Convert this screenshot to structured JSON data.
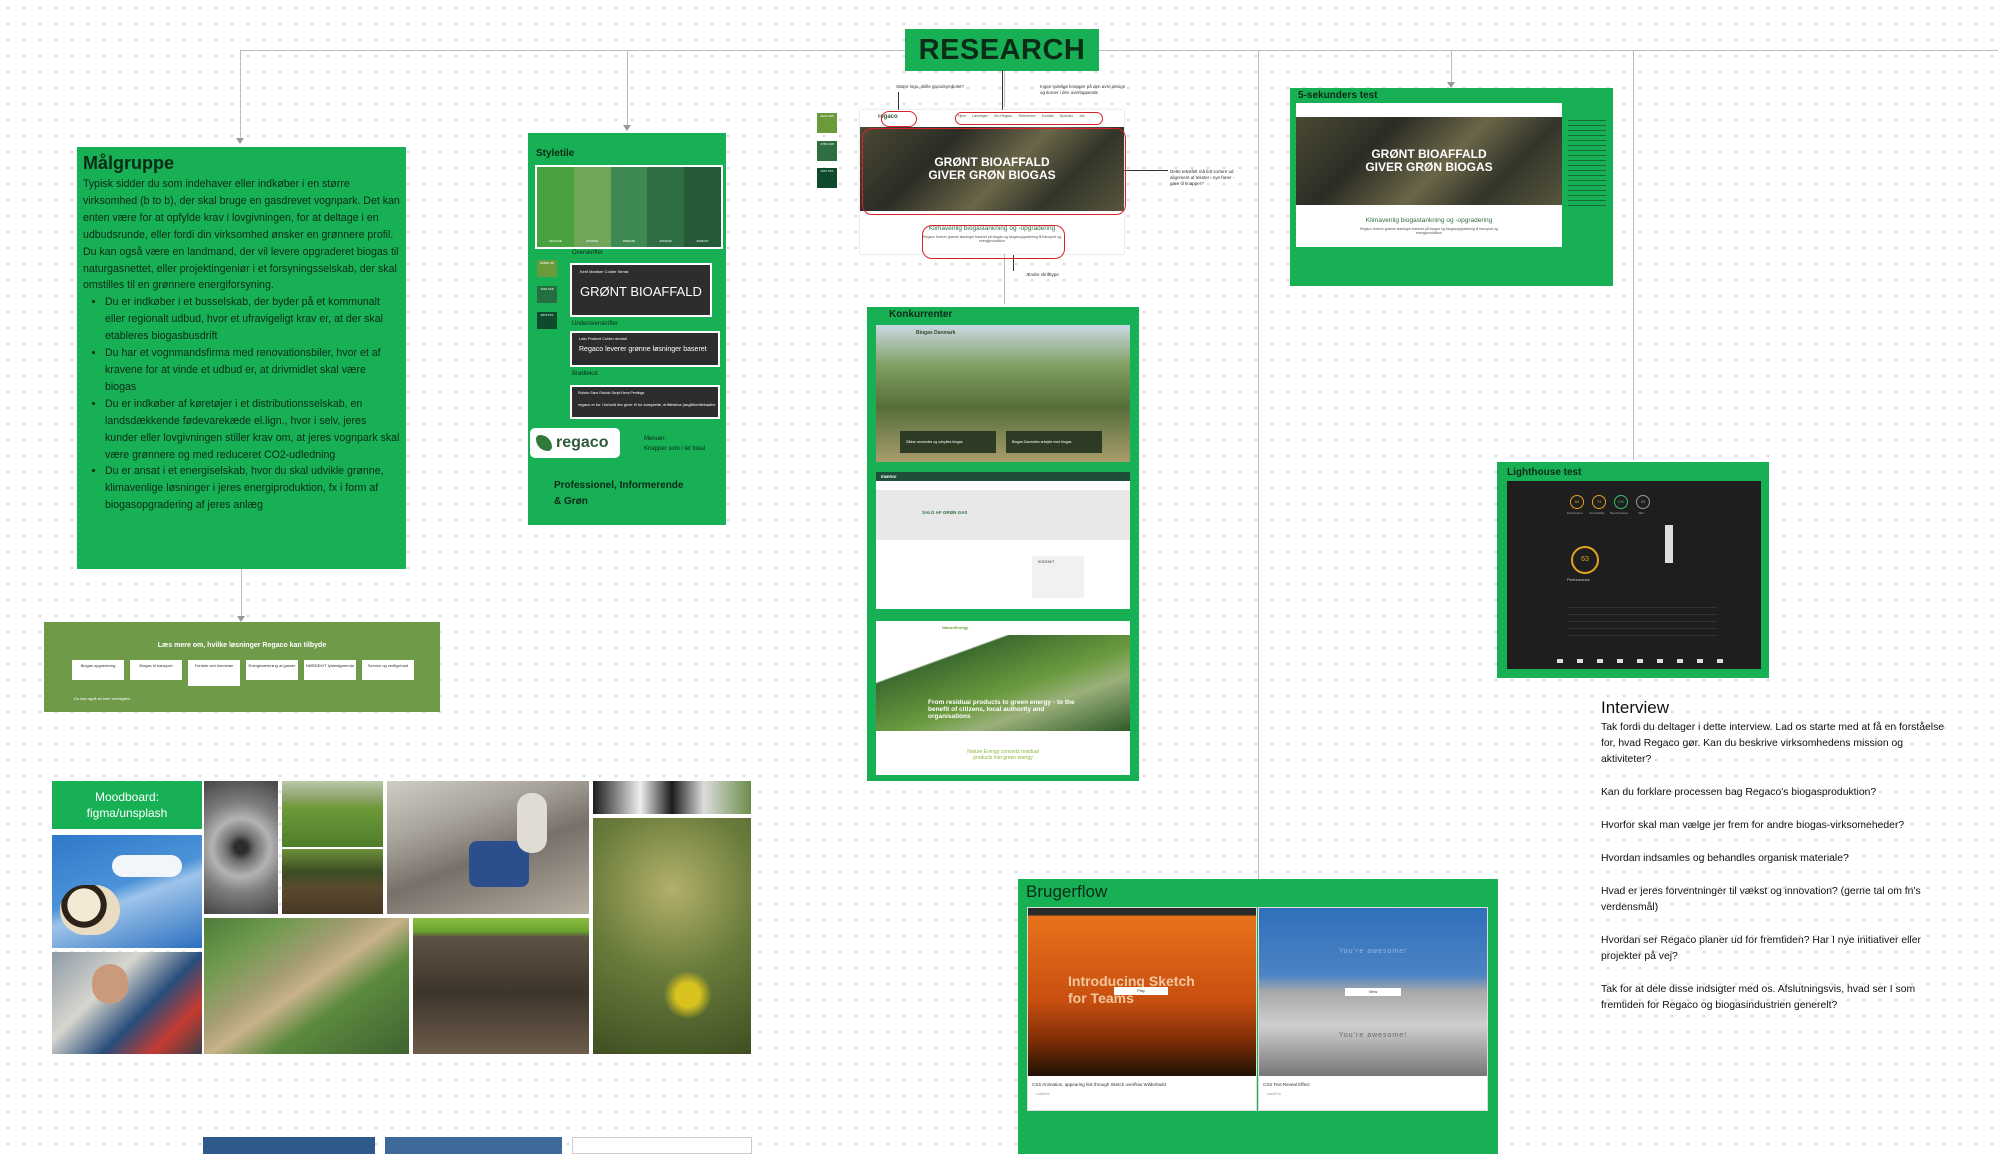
{
  "title": "RESEARCH",
  "malgruppe": {
    "heading": "Målgruppe",
    "intro": "Typisk sidder du som indehaver eller indkøber i en større virksomhed (b to b), der skal bruge en gasdrevet vognpark. Det kan enten være for at opfylde krav i lovgivningen, for at deltage i en udbudsrunde, eller fordi din virksomhed ønsker en grønnere profil.",
    "intro2": "Du kan også være en landmand, der vil levere opgraderet biogas til naturgasnettet, eller projektingeniør i et forsyningsselskab, der skal omstilles til en grønnere energiforsyning.",
    "bullets": [
      "Du er indkøber i et busselskab, der byder på et kommunalt eller regionalt udbud, hvor et ufravigeligt krav er, at der skal etableres biogasbusdrift",
      "Du har et vognmandsfirma med renovationsbiler, hvor et af kravene for at vinde et udbud er, at drivmidlet skal være biogas",
      "Du er indkøber af køretøjer i et distributionsselskab, en landsdækkende fødevarekæde el.lign., hvor i selv, jeres kunder eller lovgivningen stiller krav om, at jeres vognpark skal være grønnere og med reduceret CO2-udledning",
      "Du er ansat i et energiselskab, hvor du skal udvikle grønne, klimavenlige løsninger i jeres energiproduktion, fx i form af biogasopgradering af jeres anlæg"
    ]
  },
  "campaign": {
    "title": "Læs mere om, hvilke løsninger Regaco kan tilbyde",
    "chips": [
      "Biogas opgradering",
      "Biogas til transport",
      "Fordele ved biometan",
      "Energimærkning af gasser",
      "NØRDEKIT fyldestgørende",
      "Service og vedligehold"
    ],
    "footer": "Du kan også se hele oversigten"
  },
  "moodboard": {
    "label_line1": "Moodboard:",
    "label_line2": "figma/unsplash"
  },
  "styletile": {
    "title": "Styletile",
    "colors": [
      "#4aa23e",
      "#6fa65a",
      "#3e8a52",
      "#2f6d42",
      "#245a37"
    ],
    "color_labels": [
      "#4AA23E",
      "#70A55A",
      "#3E8A52",
      "#2F6D42",
      "#245A37"
    ],
    "mini_colors": [
      "#6b9a3a",
      "#256e40",
      "#0e4a2c"
    ],
    "mini_labels": [
      "8EB3D 38",
      "409A 5C8",
      "4879 57A"
    ],
    "overskrifter_label": "Overskrifter",
    "overskrift_meta": "Kerll   Montser   Colder Serrat",
    "overskrift_sample": "GRØNT BIOAFFALD",
    "underoverskrift_label": "Underoverskrifter",
    "underoverskrift_meta": "Lato   Probert   Colder dealari",
    "underoverskrift_sample": "Regaco leverer grønne løsninger baseret",
    "broedtekst_label": "Brødtekst",
    "broedtekst_meta": "Roboto Sans   Roboto Script   Nexa Pentings",
    "broedtekst_sample": "regaco er for i forhold der giver til for komplette, drifttestiva (anglitikmifekaalhe",
    "logo_text": "regaco",
    "menu_label": "Menuer:",
    "menu_desc": "Knapper som i let fokal",
    "tagline_line1": "Professionel, Informerende",
    "tagline_line2": "& Grøn"
  },
  "website": {
    "logo": "regaco",
    "nav": [
      "Hjem",
      "Løsninger",
      "Om Regaco",
      "Referencer",
      "Kontakt",
      "Nyheder",
      "Job"
    ],
    "hero_line1": "GRØNT BIOAFFALD",
    "hero_line2": "GIVER GRØN BIOGAS",
    "subheading": "Klimavenlig biogastankning og -opgradering",
    "body": "Regaco leverer grønne løsninger baseret på biogas og biogasopgradering til transport og energiproduktion",
    "swatch_labels": [
      "4EA5 2E5",
      "47BA C38",
      "4007 57A"
    ],
    "note_top_left": "Større logo, skille grundsymbolet?",
    "note_top_right": "Ingen tydelige knapper på den øvre design og ikoner i den overlappende",
    "note_right": "Dette tekstfelt må lidt sortere ud alignment af tekster i nye faner - gøre til knapper?",
    "note_bottom": "Ændre skrifttype"
  },
  "fivesec": {
    "title": "5-sekunders test",
    "hero_line1": "GRØNT BIOAFFALD",
    "hero_line2": "GIVER GRØN BIOGAS",
    "subheading": "Klimavenlig biogastankning og -opgradering",
    "body": "Regaco leverer grønne løsninger baseret på biogas og biogasopgradering til transport og energiproduktion"
  },
  "konkurrenter": {
    "title": "Konkurrenter",
    "site1_logo": "Biogas Danmark",
    "site1_cards": [
      "Sådan anvendes og udnyttes biogas",
      "Biogas Danmarks arbejde med biogas"
    ],
    "site2_logo": "ENERGI",
    "site2_heading": "SALG AF GRØN GAS",
    "site2_button": "KONTAKT",
    "site3_logo": "NatureEnergy",
    "site3_hero": "From residual products to green energy - to the benefit of citizens, local authority and organisations",
    "site3_footer_line1": "Nature Energy converts residual",
    "site3_footer_line2": "products into green energy"
  },
  "lighthouse": {
    "title": "Lighthouse test",
    "scores": [
      "63",
      "74",
      "100",
      "83"
    ],
    "score_labels": [
      "Performance",
      "Accessibility",
      "Best Practices",
      "SEO"
    ],
    "main_score": "63",
    "main_label": "Performance"
  },
  "brugerflow": {
    "title": "Brugerflow",
    "card1_title_line1": "Introducing Sketch",
    "card1_title_line2": "for Teams",
    "card1_button": "Play",
    "card1_caption": "CSS Animation, appearing link through Sketch overflow Wilderbuild",
    "card1_author": "Lukefree",
    "card2_line1": "You're awesome!",
    "card2_button": "View",
    "card2_line2": "You're awesome!",
    "card2_caption": "CSS Text Reveal Effect",
    "card2_author": "IssuePro"
  },
  "interview": {
    "heading": "Interview",
    "questions": [
      "Tak fordi du deltager i dette interview. Lad os starte med at få en forståelse for, hvad Regaco gør. Kan du beskrive virksomhedens mission og aktiviteter?",
      "Kan du forklare processen bag Regaco's biogasproduktion?",
      "Hvorfor skal man vælge jer frem for andre biogas-virksomeheder?",
      "Hvordan indsamles og behandles organisk materiale?",
      "Hvad er jeres forventninger til vækst og innovation? (gerne tal om fn's verdensmål)",
      "Hvordan ser Regaco planer ud for fremtiden? Har I nye initiativer eller projekter på vej?",
      "Tak for at dele disse indsigter med os. Afslutningsvis, hvad ser I som fremtiden for Regaco og biogasindustrien generelt?"
    ]
  }
}
